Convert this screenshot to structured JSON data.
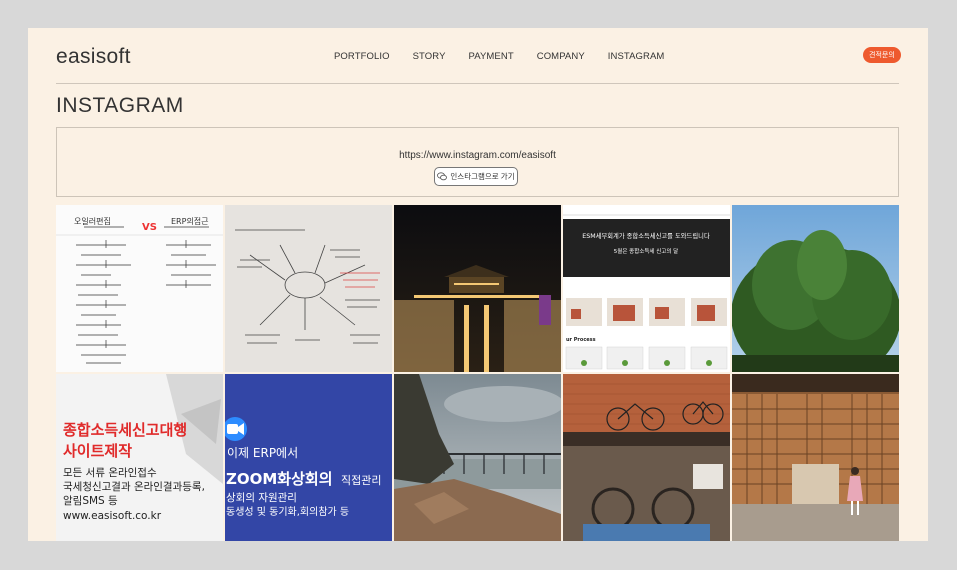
{
  "header": {
    "logo": "easisoft",
    "nav": [
      "PORTFOLIO",
      "STORY",
      "PAYMENT",
      "COMPANY",
      "INSTAGRAM"
    ],
    "cta": "견적문의"
  },
  "main": {
    "title": "INSTAGRAM",
    "url": "https://www.instagram.com/easisoft",
    "button_label": "인스타그램으로 가기"
  },
  "tiles": {
    "t1": {
      "vs": "VS"
    },
    "t4": {
      "headline": "ESM세무회계가 종합소득세신고를 도와드립니다",
      "sub": "5월은 종합소득세 신고의 달",
      "process": "ur Process"
    },
    "t6": {
      "line1": "종합소득세신고대행",
      "line2": "사이트제작",
      "line3": "모든 서류 온라인접수",
      "line4": "국세청신고결과 온라인결과등록,",
      "line5": "알림SMS 등",
      "line6": "www.easisoft.co.kr"
    },
    "t7": {
      "line1": "이제 ERP에서",
      "line2a": "ZOOM화상회의",
      "line2b": "직접관리",
      "line3": "상회의 자원관리",
      "line4": "동생성 및 동기화,회의참가 등"
    }
  },
  "colors": {
    "accent": "#ee5a2e",
    "page_bg": "#fbf1e4",
    "zoom_blue": "#3346a6"
  }
}
